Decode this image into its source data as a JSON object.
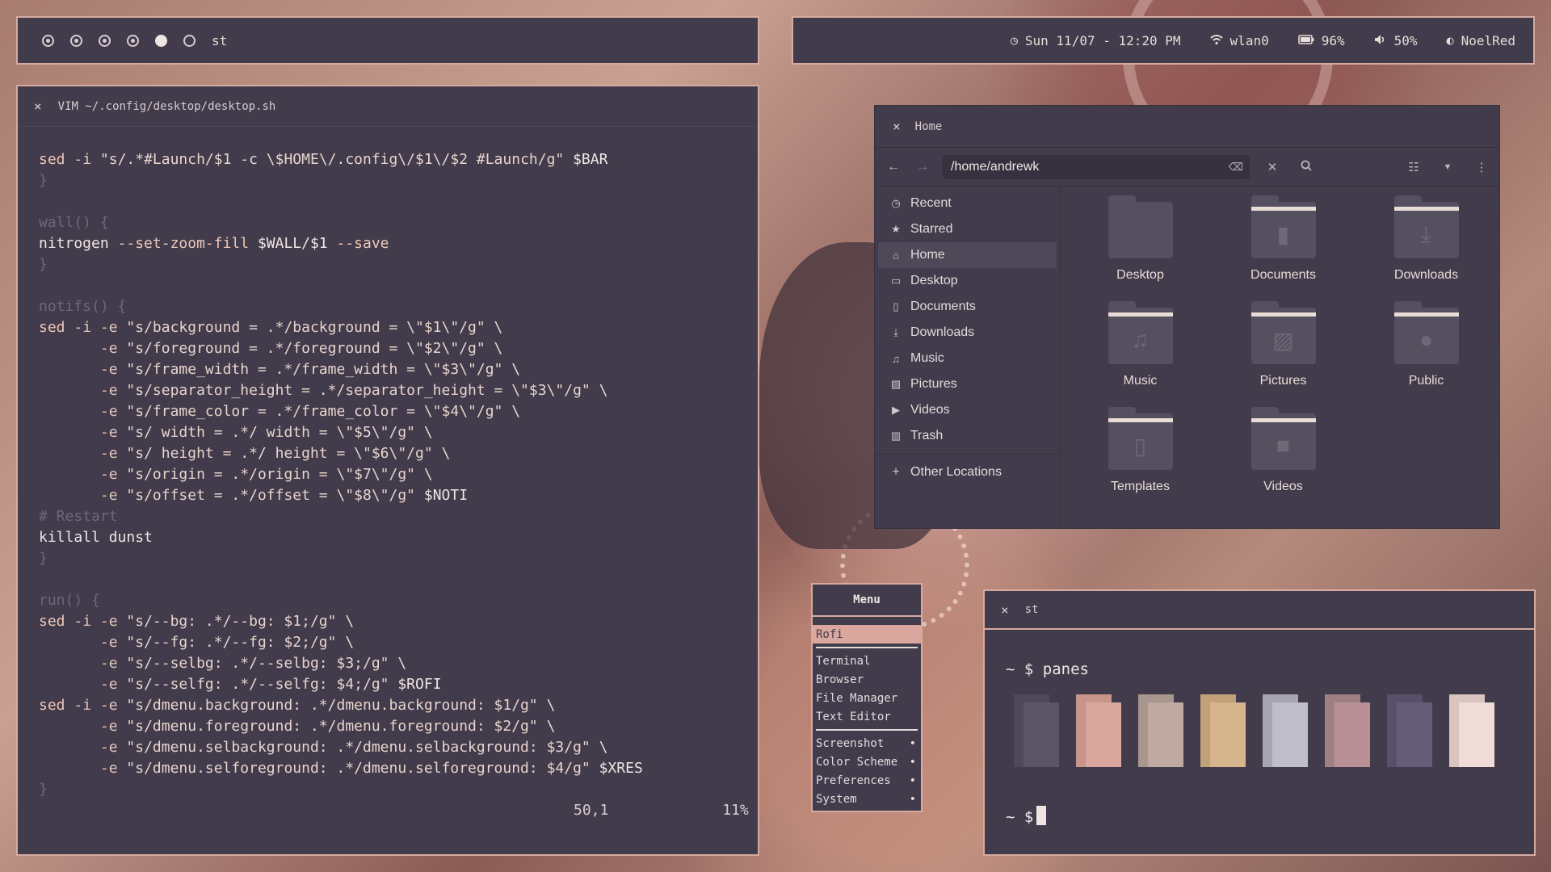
{
  "top_bar_left": {
    "workspaces": [
      "dot",
      "dot",
      "dot",
      "dot",
      "full",
      "empty"
    ],
    "title": "st"
  },
  "top_bar_right": {
    "clock": "Sun 11/07 - 12:20 PM",
    "network": "wlan0",
    "battery": "96%",
    "volume": "50%",
    "user": "NoelRed",
    "icons": [
      "clock-icon",
      "wifi-icon",
      "battery-icon",
      "volume-icon",
      "theme-icon"
    ]
  },
  "vim": {
    "close": "×",
    "title": "VIM ~/.config/desktop/desktop.sh",
    "ruler_pos": "50,1",
    "ruler_pct": "11%"
  },
  "files": {
    "close": "×",
    "title": "Home",
    "path": "/home/andrewk",
    "sidebar": [
      {
        "label": "Recent",
        "icon": "clock-icon"
      },
      {
        "label": "Starred",
        "icon": "star-icon"
      },
      {
        "label": "Home",
        "icon": "home-icon"
      },
      {
        "label": "Desktop",
        "icon": "desktop-icon"
      },
      {
        "label": "Documents",
        "icon": "document-icon"
      },
      {
        "label": "Downloads",
        "icon": "download-icon"
      },
      {
        "label": "Music",
        "icon": "music-icon"
      },
      {
        "label": "Pictures",
        "icon": "picture-icon"
      },
      {
        "label": "Videos",
        "icon": "video-icon"
      },
      {
        "label": "Trash",
        "icon": "trash-icon"
      },
      {
        "label": "Other Locations",
        "icon": "plus-icon"
      }
    ],
    "folders": [
      {
        "label": "Desktop",
        "icon": "desktop-folder-icon"
      },
      {
        "label": "Documents",
        "icon": "documents-folder-icon"
      },
      {
        "label": "Downloads",
        "icon": "downloads-folder-icon"
      },
      {
        "label": "Music",
        "icon": "music-folder-icon"
      },
      {
        "label": "Pictures",
        "icon": "pictures-folder-icon"
      },
      {
        "label": "Public",
        "icon": "public-folder-icon"
      },
      {
        "label": "Templates",
        "icon": "templates-folder-icon"
      },
      {
        "label": "Videos",
        "icon": "videos-folder-icon"
      }
    ]
  },
  "menu": {
    "title": "Menu",
    "selected": "Rofi",
    "group1": [
      "Terminal",
      "Browser",
      "File Manager",
      "Text Editor"
    ],
    "group2": [
      "Screenshot",
      "Color Scheme",
      "Preferences",
      "System"
    ],
    "marker": "•"
  },
  "st": {
    "close": "×",
    "title": "st",
    "prompt1": "~ $ panes",
    "prompt2": "~ $",
    "swatches": [
      {
        "back": "#4f4858",
        "front": "#5a5464"
      },
      {
        "back": "#c9948a",
        "front": "#d9a79d"
      },
      {
        "back": "#a8968f",
        "front": "#bfaaa2"
      },
      {
        "back": "#c2a07a",
        "front": "#d6b48d"
      },
      {
        "back": "#a7a6b0",
        "front": "#bfbec8"
      },
      {
        "back": "#a07f84",
        "front": "#b89096"
      },
      {
        "back": "#575068",
        "front": "#655d78"
      },
      {
        "back": "#d9c4bf",
        "front": "#efdcd6"
      }
    ]
  }
}
